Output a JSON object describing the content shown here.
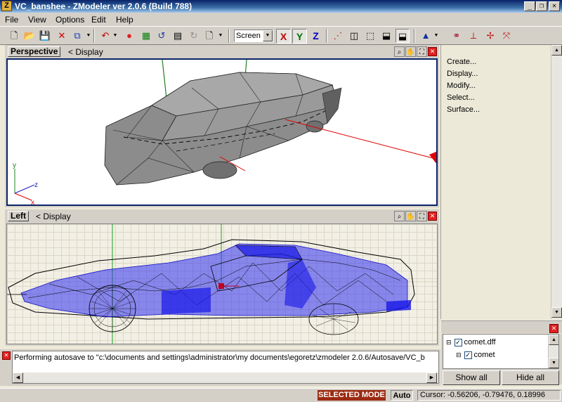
{
  "window": {
    "icon_letter": "Z",
    "title": "VC_banshee - ZModeler ver 2.0.6 (Build 788)",
    "min": "_",
    "max": "❐",
    "close": "✕"
  },
  "menu": {
    "file": "File",
    "view": "View",
    "options": "Options",
    "edit": "Edit",
    "help": "Help"
  },
  "toolbar": {
    "screen_value": "Screen",
    "axis_x": "X",
    "axis_y": "Y",
    "axis_z": "Z",
    "colors": {
      "x": "#c00000",
      "y": "#007000",
      "z": "#0000c0"
    }
  },
  "viewports": {
    "perspective": {
      "name": "Perspective",
      "display": "<  Display",
      "axis_y": "y",
      "axis_z": "z",
      "axis_x": "x"
    },
    "left": {
      "name": "Left",
      "display": "<  Display"
    }
  },
  "right_panel": {
    "commands": [
      "Create...",
      "Display...",
      "Modify...",
      "Select...",
      "Surface..."
    ]
  },
  "tree": {
    "items": [
      {
        "label": "comet.dff",
        "checked": true
      },
      {
        "label": "comet",
        "checked": true
      }
    ],
    "show_all": "Show all",
    "hide_all": "Hide all"
  },
  "log": {
    "message": "Performing autosave to \"c:\\documents and settings\\administrator\\my documents\\egoretz\\zmodeler 2.0.6/Autosave/VC_b"
  },
  "status": {
    "mode": "SELECTED MODE",
    "auto": "Auto",
    "cursor": "Cursor: -0.56206, -0.79476, 0.18996"
  },
  "colors": {
    "title_gradient_start": "#0a246a",
    "viewport_active_border": "#0a246a",
    "wireframe_blue": "#2020ff",
    "mode_badge": "#9c2a12"
  }
}
